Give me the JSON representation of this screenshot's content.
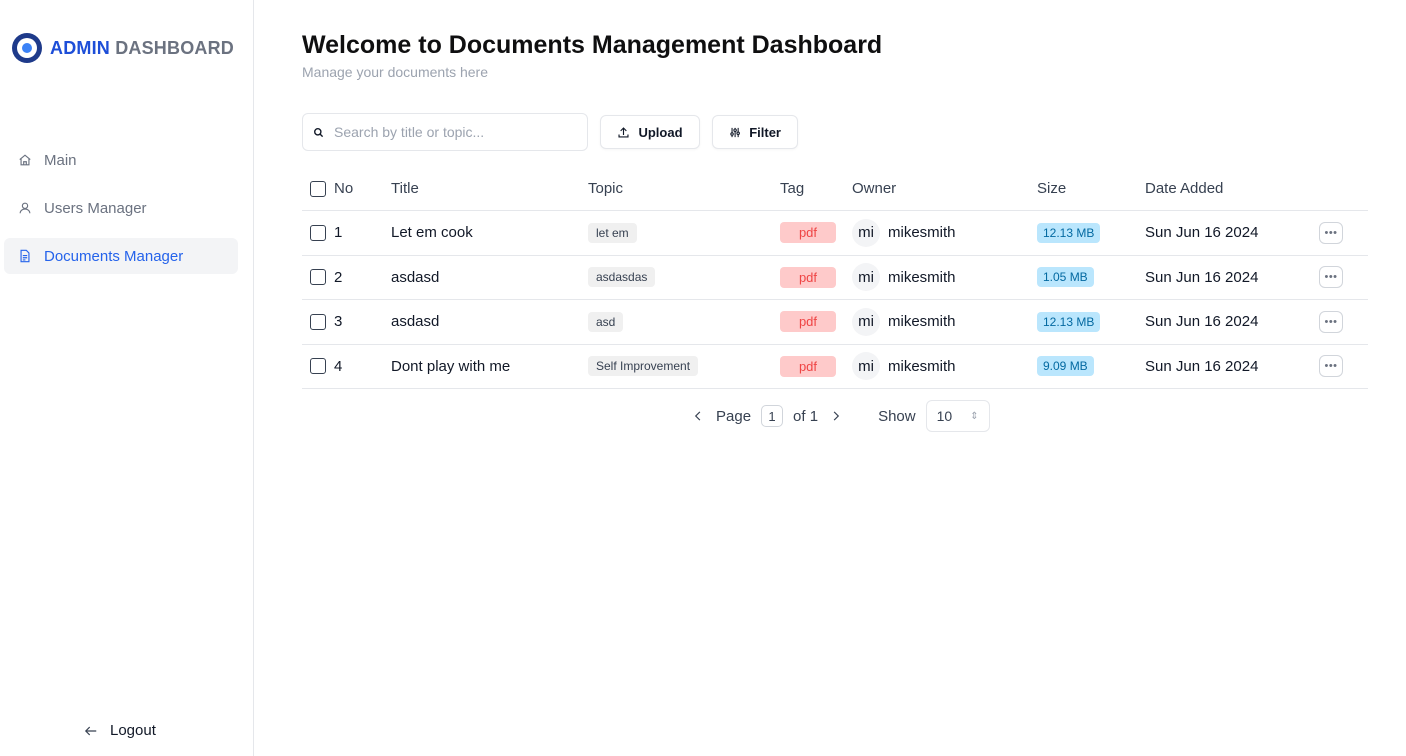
{
  "brand": {
    "admin": "ADMIN",
    "dashboard": "DASHBOARD"
  },
  "sidebar": {
    "items": [
      {
        "label": "Main",
        "icon": "home-icon",
        "active": false
      },
      {
        "label": "Users Manager",
        "icon": "user-icon",
        "active": false
      },
      {
        "label": "Documents Manager",
        "icon": "document-icon",
        "active": true
      }
    ],
    "logout": "Logout"
  },
  "header": {
    "title": "Welcome to Documents Management Dashboard",
    "subtitle": "Manage your documents here"
  },
  "toolbar": {
    "search_placeholder": "Search by title or topic...",
    "upload_label": "Upload",
    "filter_label": "Filter"
  },
  "table": {
    "columns": [
      "No",
      "Title",
      "Topic",
      "Tag",
      "Owner",
      "Size",
      "Date Added"
    ],
    "rows": [
      {
        "no": "1",
        "title": "Let em cook",
        "topic": "let em",
        "tag": "pdf",
        "owner_initials": "mi",
        "owner": "mikesmith",
        "size": "12.13 MB",
        "date": "Sun Jun 16 2024"
      },
      {
        "no": "2",
        "title": "asdasd",
        "topic": "asdasdas",
        "tag": "pdf",
        "owner_initials": "mi",
        "owner": "mikesmith",
        "size": "1.05 MB",
        "date": "Sun Jun 16 2024"
      },
      {
        "no": "3",
        "title": "asdasd",
        "topic": "asd",
        "tag": "pdf",
        "owner_initials": "mi",
        "owner": "mikesmith",
        "size": "12.13 MB",
        "date": "Sun Jun 16 2024"
      },
      {
        "no": "4",
        "title": "Dont play with me",
        "topic": "Self Improvement",
        "tag": "pdf",
        "owner_initials": "mi",
        "owner": "mikesmith",
        "size": "9.09 MB",
        "date": "Sun Jun 16 2024"
      }
    ]
  },
  "pagination": {
    "page_label": "Page",
    "current_page": "1",
    "of_label": "of 1",
    "show_label": "Show",
    "page_size": "10"
  },
  "colors": {
    "accent": "#2563eb",
    "tag_bg": "#fecaca",
    "tag_text": "#ef4444",
    "size_bg": "#bae6fd"
  }
}
